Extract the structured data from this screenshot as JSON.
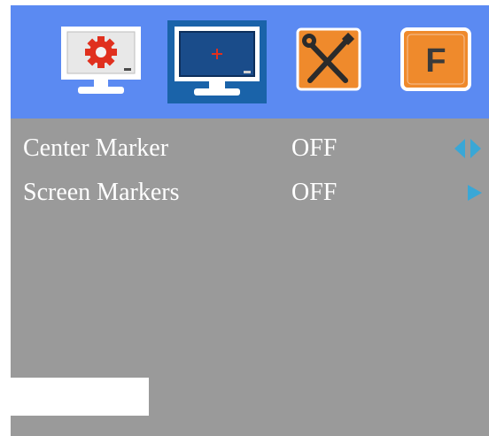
{
  "colors": {
    "header_bg": "#5b8af2",
    "selected_tab_bg": "#1a63a9",
    "panel_bg": "#9a9a9a",
    "arrow": "#3aa7d6",
    "tools_tile": "#ef8a2c",
    "function_tile": "#ef8a2c"
  },
  "tabs": [
    {
      "icon": "monitor-gear-icon",
      "selected": false
    },
    {
      "icon": "monitor-crosshair-icon",
      "selected": true
    },
    {
      "icon": "wrench-screwdriver-icon",
      "selected": false
    },
    {
      "icon": "function-f-icon",
      "letter": "F",
      "selected": false
    }
  ],
  "menu": {
    "items": [
      {
        "label": "Center Marker",
        "value": "OFF",
        "arrows": "left-right-arrows-icon"
      },
      {
        "label": "Screen Markers",
        "value": "OFF",
        "arrows": "right-arrow-icon"
      }
    ]
  }
}
